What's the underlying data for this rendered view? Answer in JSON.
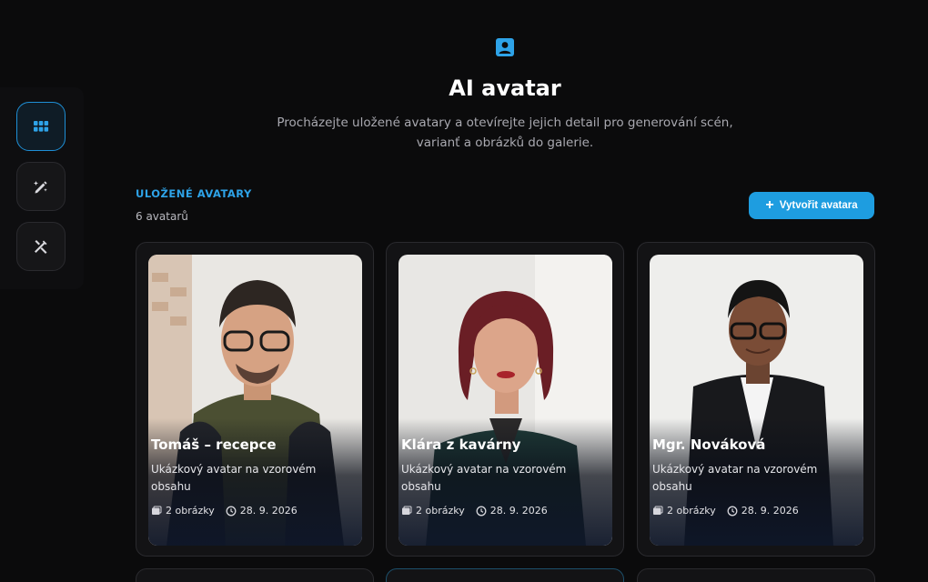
{
  "sidebar": {
    "items": [
      {
        "icon": "grid-icon",
        "active": true
      },
      {
        "icon": "edit-sparkle-icon",
        "active": false
      },
      {
        "icon": "tools-icon",
        "active": false
      }
    ]
  },
  "header": {
    "icon": "user-square-icon",
    "title": "AI avatar",
    "subtitle": "Procházejte uložené avatary a otevírejte jejich detail pro generování scén, varianť a obrázků do galerie."
  },
  "section": {
    "label": "ULOŽENÉ AVATARY",
    "count": "6 avatarů",
    "create_label": "Vytvořit avatara"
  },
  "avatars": [
    {
      "name": "Tomáš – recepce",
      "description": "Ukázkový avatar na vzorovém obsahu",
      "images": "2 obrázky",
      "date": "28. 9. 2026"
    },
    {
      "name": "Klára z kavárny",
      "description": "Ukázkový avatar na vzorovém obsahu",
      "images": "2 obrázky",
      "date": "28. 9. 2026"
    },
    {
      "name": "Mgr. Nováková",
      "description": "Ukázkový avatar na vzorovém obsahu",
      "images": "2 obrázky",
      "date": "28. 9. 2026"
    }
  ],
  "colors": {
    "accent": "#1e9de0",
    "background": "#0b0b0c",
    "card": "#131315"
  }
}
